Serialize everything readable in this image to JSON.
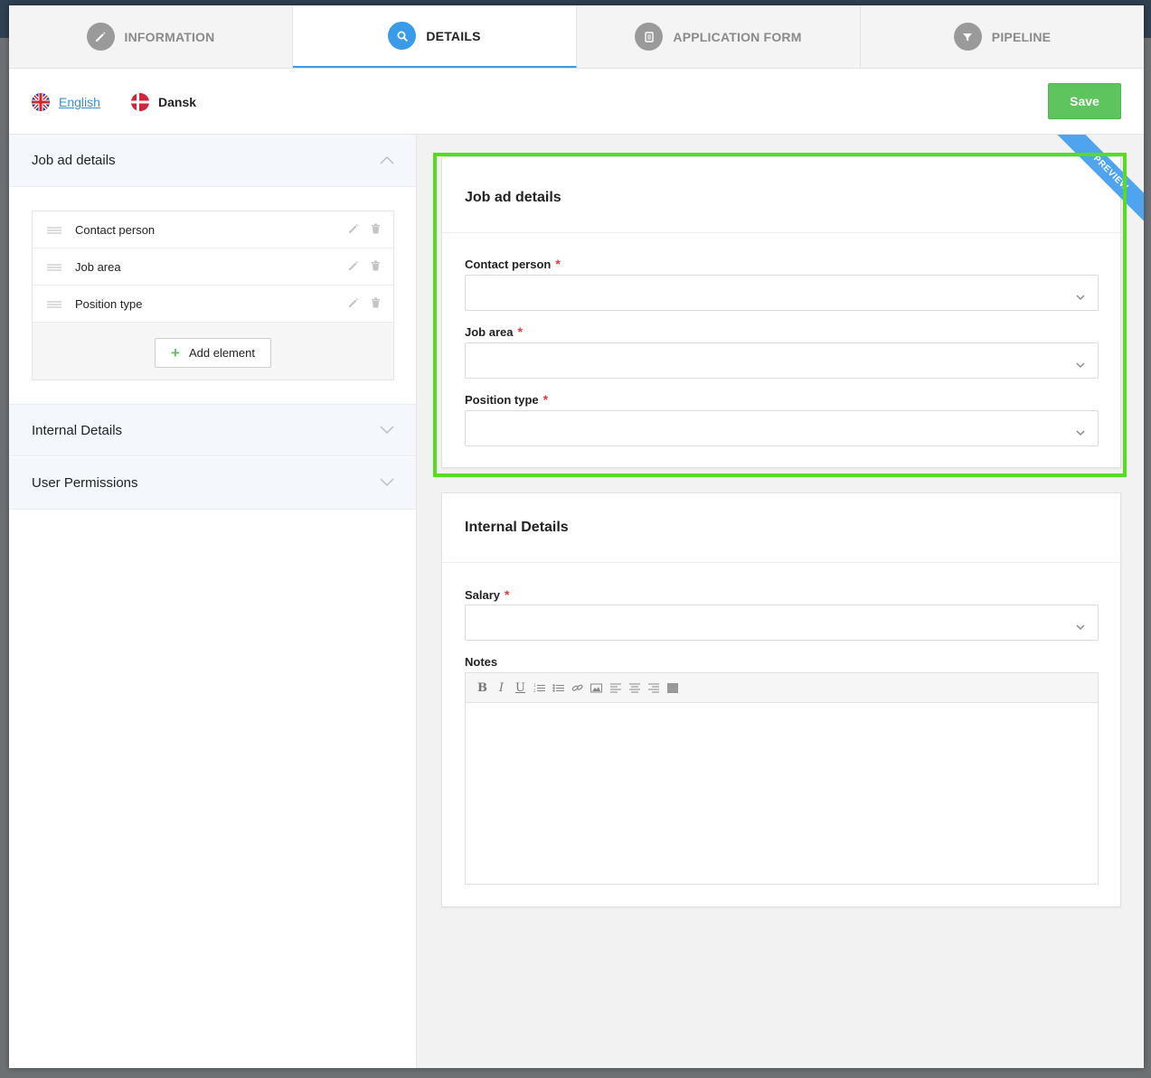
{
  "tabs": [
    {
      "label": "INFORMATION",
      "icon": "pencil-icon",
      "active": false
    },
    {
      "label": "DETAILS",
      "icon": "search-icon",
      "active": true
    },
    {
      "label": "APPLICATION FORM",
      "icon": "form-icon",
      "active": false
    },
    {
      "label": "PIPELINE",
      "icon": "funnel-icon",
      "active": false
    }
  ],
  "languages": [
    {
      "label": "English",
      "flag": "uk-flag",
      "active": true
    },
    {
      "label": "Dansk",
      "flag": "denmark-flag",
      "active": false
    }
  ],
  "save_label": "Save",
  "sidebar": {
    "sections": [
      {
        "title": "Job ad details",
        "expanded": true
      },
      {
        "title": "Internal Details",
        "expanded": false
      },
      {
        "title": "User Permissions",
        "expanded": false
      }
    ],
    "elements": [
      {
        "label": "Contact person"
      },
      {
        "label": "Job area"
      },
      {
        "label": "Position type"
      }
    ],
    "add_element_label": "Add element"
  },
  "preview": {
    "ribbon": "PREVIEW",
    "job_card": {
      "title": "Job ad details",
      "fields": [
        {
          "label": "Contact person",
          "required": "*",
          "value": ""
        },
        {
          "label": "Job area",
          "required": "*",
          "value": ""
        },
        {
          "label": "Position type",
          "required": "*",
          "value": ""
        }
      ]
    },
    "internal_card": {
      "title": "Internal Details",
      "salary_label": "Salary",
      "salary_required": "*",
      "notes_label": "Notes",
      "notes_value": ""
    }
  },
  "colors": {
    "accent": "#3a9be8",
    "save": "#5ec45e",
    "highlight": "#55dd22",
    "required": "#e23b3b",
    "ribbon": "#4ea4ee"
  }
}
